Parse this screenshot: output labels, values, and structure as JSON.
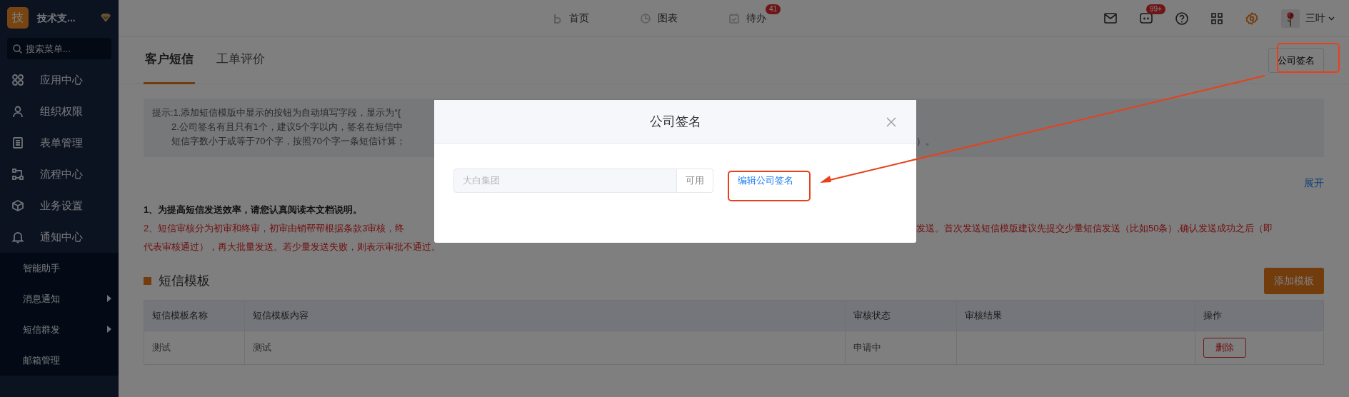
{
  "sidebar": {
    "brand": {
      "logo": "技",
      "name": "技术支..."
    },
    "search": {
      "placeholder": "搜索菜单..."
    },
    "items": [
      {
        "label": "应用中心"
      },
      {
        "label": "组织权限"
      },
      {
        "label": "表单管理"
      },
      {
        "label": "流程中心"
      },
      {
        "label": "业务设置"
      },
      {
        "label": "通知中心",
        "children": [
          {
            "label": "智能助手",
            "has_submenu": false
          },
          {
            "label": "消息通知",
            "has_submenu": true
          },
          {
            "label": "短信群发",
            "has_submenu": true
          },
          {
            "label": "邮箱管理",
            "has_submenu": false
          }
        ]
      }
    ]
  },
  "top_nav": [
    {
      "label": "首页"
    },
    {
      "label": "图表"
    },
    {
      "label": "待办",
      "badge": "41"
    }
  ],
  "toolbar": {
    "message_badge": "99+",
    "user": "三叶"
  },
  "tabs": [
    {
      "label": "客户短信",
      "selected": true
    },
    {
      "label": "工单评价",
      "selected": false
    }
  ],
  "signature_button": "公司签名",
  "hint": {
    "lines": [
      {
        "left": "提示:1.添加短信模版中显示的按钮为自动填写字段，显示为“{"
      },
      {
        "left": "2.公司签名有且只有1个，建议5个字以内，签名在短信中"
      },
      {
        "left": "短信字数小于或等于70个字，按照70个字一条短信计算；",
        "right": "）。"
      }
    ]
  },
  "expand_link": "展开",
  "notice": [
    {
      "kind": "note",
      "left": "1、为提高短信发送效率，请您认真阅读本文档说明。"
    },
    {
      "kind": "warning",
      "left": "2、短信审核分为初审和终审，初审由销帮帮根据条款3审核，终",
      "right": "发送。首次发送短信模版建议先提交少量短信发送（比如50条）,确认发送成功之后（即"
    },
    {
      "kind": "warning",
      "left": "代表审核通过），再大批量发送。若少量发送失败，则表示审批不通过。"
    }
  ],
  "section": {
    "title": "短信模板",
    "add_button": "添加模板"
  },
  "table": {
    "columns": [
      "短信模板名称",
      "短信模板内容",
      "审核状态",
      "审核结果",
      "操作"
    ],
    "rows": [
      {
        "name": "测试",
        "content": "测试",
        "status": "申请中",
        "delete_button": "删除"
      }
    ]
  },
  "modal": {
    "title": "公司签名",
    "signature_value": "大白集团",
    "addon": "可用",
    "edit_link": "编辑公司签名"
  }
}
